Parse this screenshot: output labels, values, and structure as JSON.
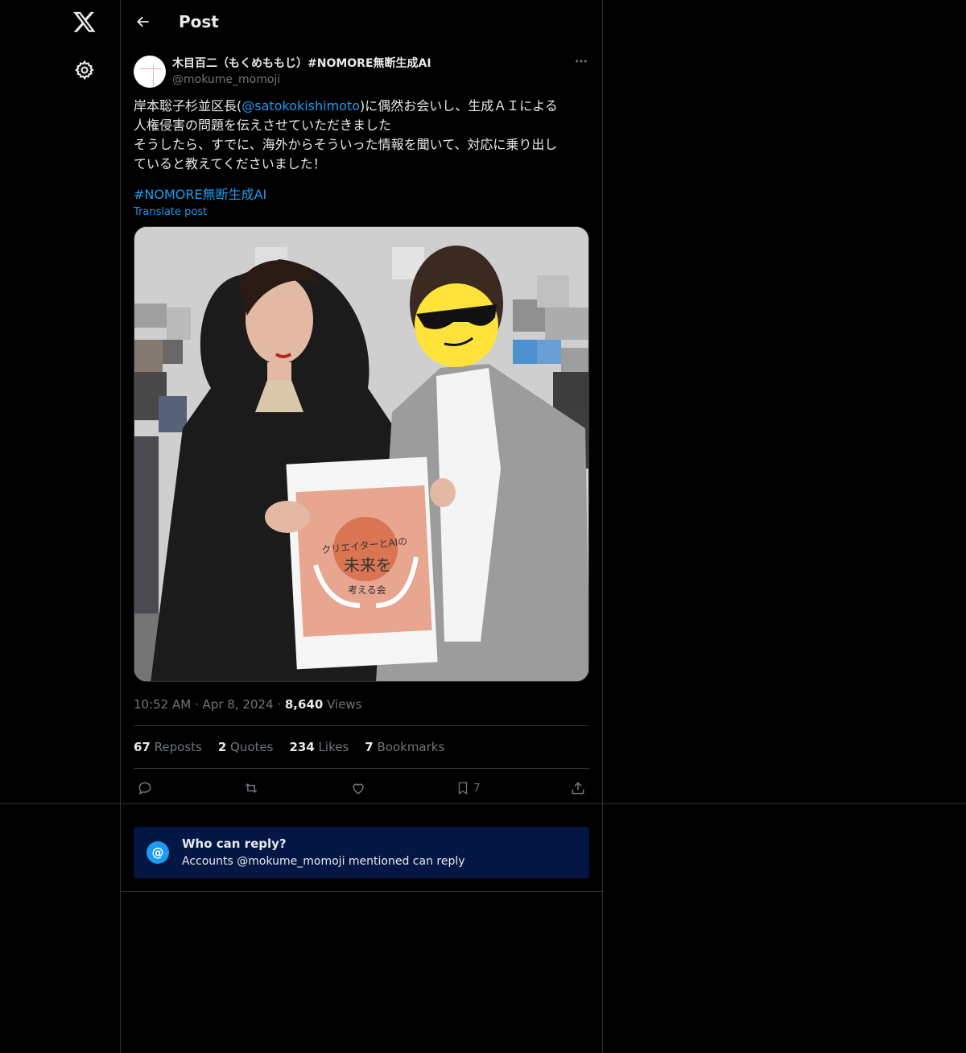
{
  "topbar": {
    "title": "Post"
  },
  "post": {
    "author": {
      "display_name": "木目百二（もくめももじ）#NOMORE無断生成AI",
      "handle": "@mokume_momoji"
    },
    "text_before_mention": "岸本聡子杉並区長(",
    "mention": "@satokokishimoto",
    "text_after_mention": ")に偶然お会いし、生成ＡＩによる\n人権侵害の問題を伝えさせていただきました\nそうしたら、すでに、海外からそういった情報を聞いて、対応に乗り出し\nていると教えてくださいました！",
    "hashtag": " #NOMORE無断生成AI",
    "translate": "Translate post",
    "media": {
      "sign_line1": "クリエイターとAIの",
      "sign_line2": "未来を",
      "sign_line3": "考える会"
    },
    "time": "10:52 AM",
    "sep1": "·",
    "date": "Apr 8, 2024",
    "sep2": "·",
    "views_count": "8,640",
    "views_label": " Views",
    "stats": {
      "reposts_count": "67",
      "reposts_label": " Reposts",
      "quotes_count": "2",
      "quotes_label": " Quotes",
      "likes_count": "234",
      "likes_label": " Likes",
      "bookmarks_count": "7",
      "bookmarks_label": " Bookmarks"
    },
    "actions": {
      "bookmark_count": "7"
    }
  },
  "who_can_reply": {
    "title": "Who can reply?",
    "subtitle": "Accounts @mokume_momoji mentioned can reply"
  },
  "colors": {
    "accent": "#1d9bf0",
    "banner_bg": "#031644",
    "border": "#2f3336"
  }
}
